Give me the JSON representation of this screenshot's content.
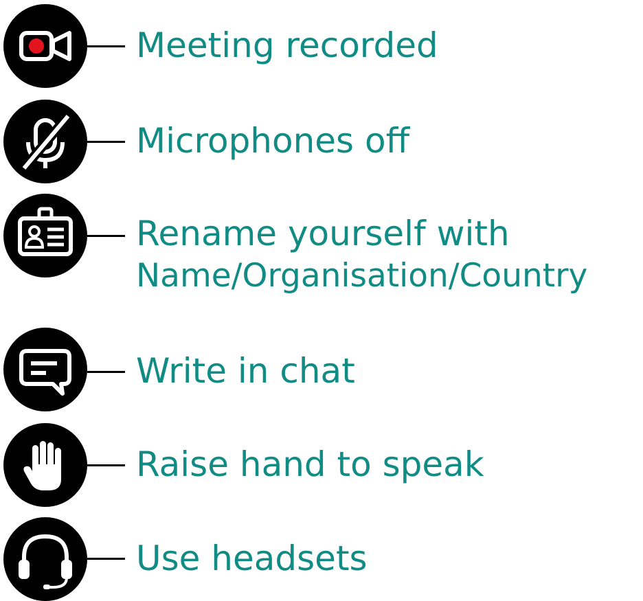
{
  "accent_color": "#118c85",
  "icon_background": "#000000",
  "record_dot_color": "#e4141e",
  "items": [
    {
      "icon": "video-camera-record-icon",
      "lines": [
        "Meeting recorded"
      ]
    },
    {
      "icon": "microphone-off-icon",
      "lines": [
        "Microphones off"
      ]
    },
    {
      "icon": "id-badge-icon",
      "lines": [
        "Rename yourself with",
        "Name/Organisation/Country"
      ]
    },
    {
      "icon": "chat-bubble-icon",
      "lines": [
        "Write in chat"
      ]
    },
    {
      "icon": "raised-hand-icon",
      "lines": [
        "Raise hand to speak"
      ]
    },
    {
      "icon": "headset-icon",
      "lines": [
        "Use headsets"
      ]
    }
  ]
}
